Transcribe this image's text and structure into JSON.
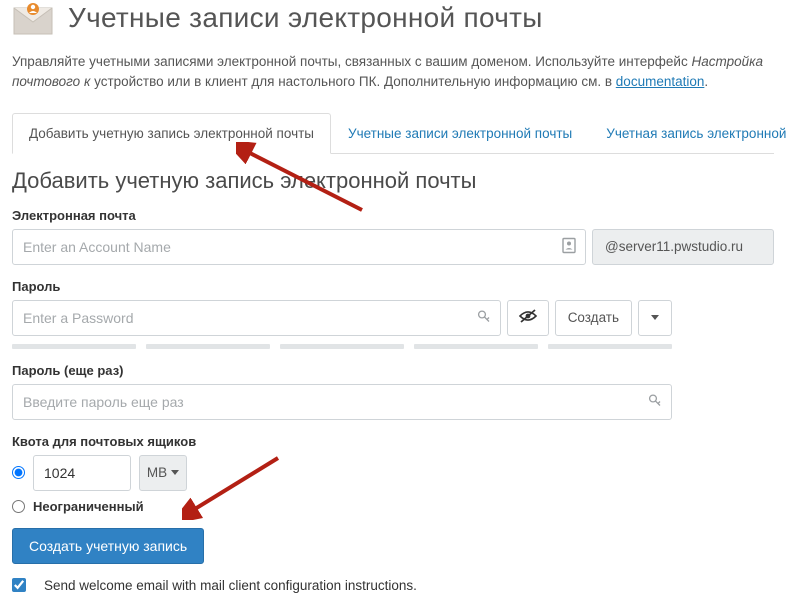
{
  "header": {
    "title": "Учетные записи электронной почты"
  },
  "intro": {
    "part1": "Управляйте учетными записями электронной почты, связанных с вашим доменом. Используйте интерфейс ",
    "italic": "Настройка почтового к",
    "part2": "устройство или в клиент для настольного ПК. Дополнительную информацию см. в ",
    "link_text": "documentation",
    "period": "."
  },
  "tabs": {
    "add": "Добавить учетную запись электронной почты",
    "accounts": "Учетные записи электронной почты",
    "default": "Учетная запись электронной почты по"
  },
  "form": {
    "heading": "Добавить учетную запись электронной почты",
    "email_label": "Электронная почта",
    "email_placeholder": "Enter an Account Name",
    "domain": "@server11.pwstudio.ru",
    "password_label": "Пароль",
    "password_placeholder": "Enter a Password",
    "generate": "Создать",
    "confirm_label": "Пароль (еще раз)",
    "confirm_placeholder": "Введите пароль еще раз",
    "quota_label": "Квота для почтовых ящиков",
    "quota_value": "1024",
    "quota_unit": "MB",
    "unlimited": "Неограниченный",
    "submit": "Создать учетную запись",
    "welcome": "Send welcome email with mail client configuration instructions."
  }
}
